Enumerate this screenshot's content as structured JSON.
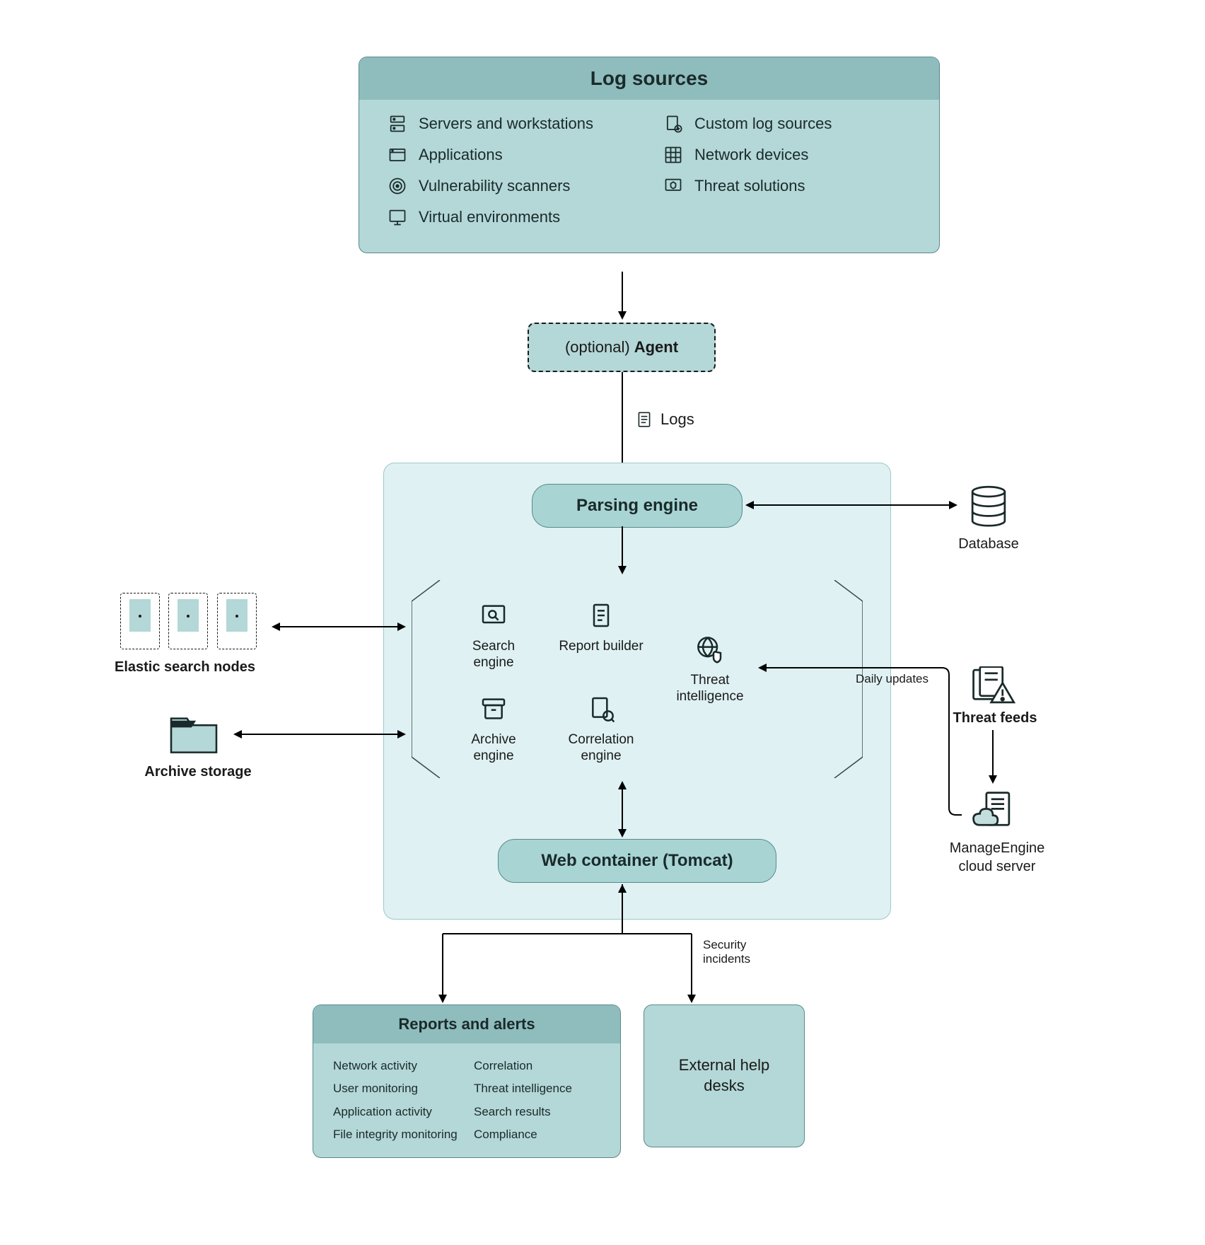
{
  "log_sources": {
    "title": "Log sources",
    "items_left": [
      "Servers and workstations",
      "Applications",
      "Vulnerability scanners",
      "Virtual environments"
    ],
    "items_right": [
      "Custom log sources",
      "Network devices",
      "Threat solutions"
    ]
  },
  "agent": {
    "label": "(optional) Agent",
    "prefix": "(optional)",
    "main": "Agent"
  },
  "logs_label": "Logs",
  "parsing_engine": "Parsing engine",
  "engines": {
    "search": "Search engine",
    "report": "Report builder",
    "archive": "Archive engine",
    "correlation": "Correlation engine",
    "threat": "Threat intelligence"
  },
  "web_container": "Web container (Tomcat)",
  "database": "Database",
  "elastic": "Elastic search nodes",
  "archive_storage": "Archive storage",
  "threat_feeds": "Threat feeds",
  "manage_engine": "ManageEngine cloud server",
  "daily_updates": "Daily updates",
  "security_incidents": "Security incidents",
  "reports": {
    "title": "Reports and alerts",
    "col1": [
      "Network activity",
      "User monitoring",
      "Application activity",
      "File integrity monitoring"
    ],
    "col2": [
      "Correlation",
      "Threat intelligence",
      "Search results",
      "Compliance"
    ]
  },
  "help_desks": "External help desks"
}
